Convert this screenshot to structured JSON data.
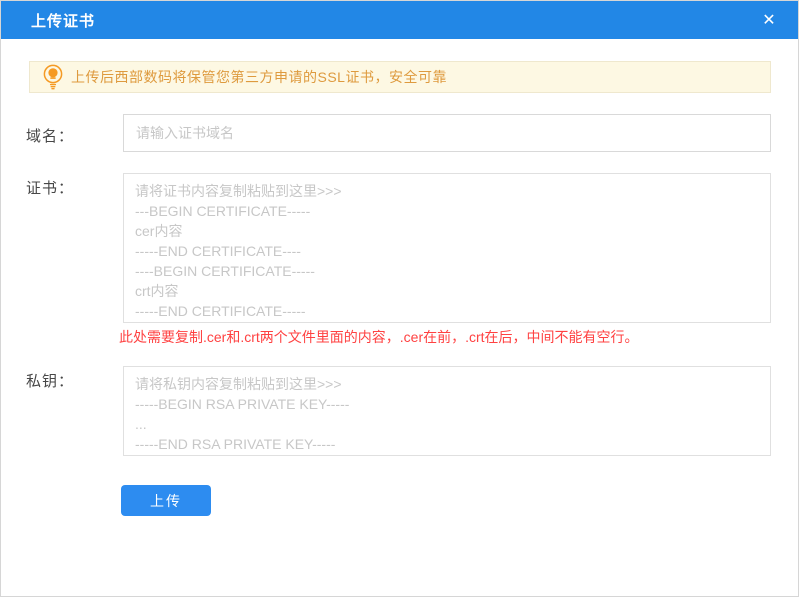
{
  "dialog": {
    "title": "上传证书",
    "close_glyph": "✕"
  },
  "notice": {
    "icon": "lightbulb-icon",
    "text": "上传后西部数码将保管您第三方申请的SSL证书，安全可靠"
  },
  "form": {
    "domain": {
      "label": "域名：",
      "value": "",
      "placeholder": "请输入证书域名"
    },
    "certificate": {
      "label": "证书：",
      "value": "",
      "placeholder": "请将证书内容复制粘贴到这里>>>\n---BEGIN CERTIFICATE-----\ncer内容\n-----END CERTIFICATE----\n----BEGIN CERTIFICATE-----\ncrt内容\n-----END CERTIFICATE-----",
      "note": "此处需要复制.cer和.crt两个文件里面的内容，.cer在前，.crt在后，中间不能有空行。"
    },
    "private_key": {
      "label": "私钥：",
      "value": "",
      "placeholder": "请将私钥内容复制粘贴到这里>>>\n-----BEGIN RSA PRIVATE KEY-----\n...\n-----END RSA PRIVATE KEY-----"
    },
    "upload_button": "上传"
  },
  "colors": {
    "header_bg": "#2287E6",
    "button_bg": "#2D8CF0",
    "notice_bg": "#FDF8E3",
    "notice_border": "#EFE8CE",
    "notice_text": "#DE9A3E",
    "icon_orange": "#F59A23",
    "error_text": "#FF4242",
    "placeholder_text": "#C7C7C7"
  }
}
